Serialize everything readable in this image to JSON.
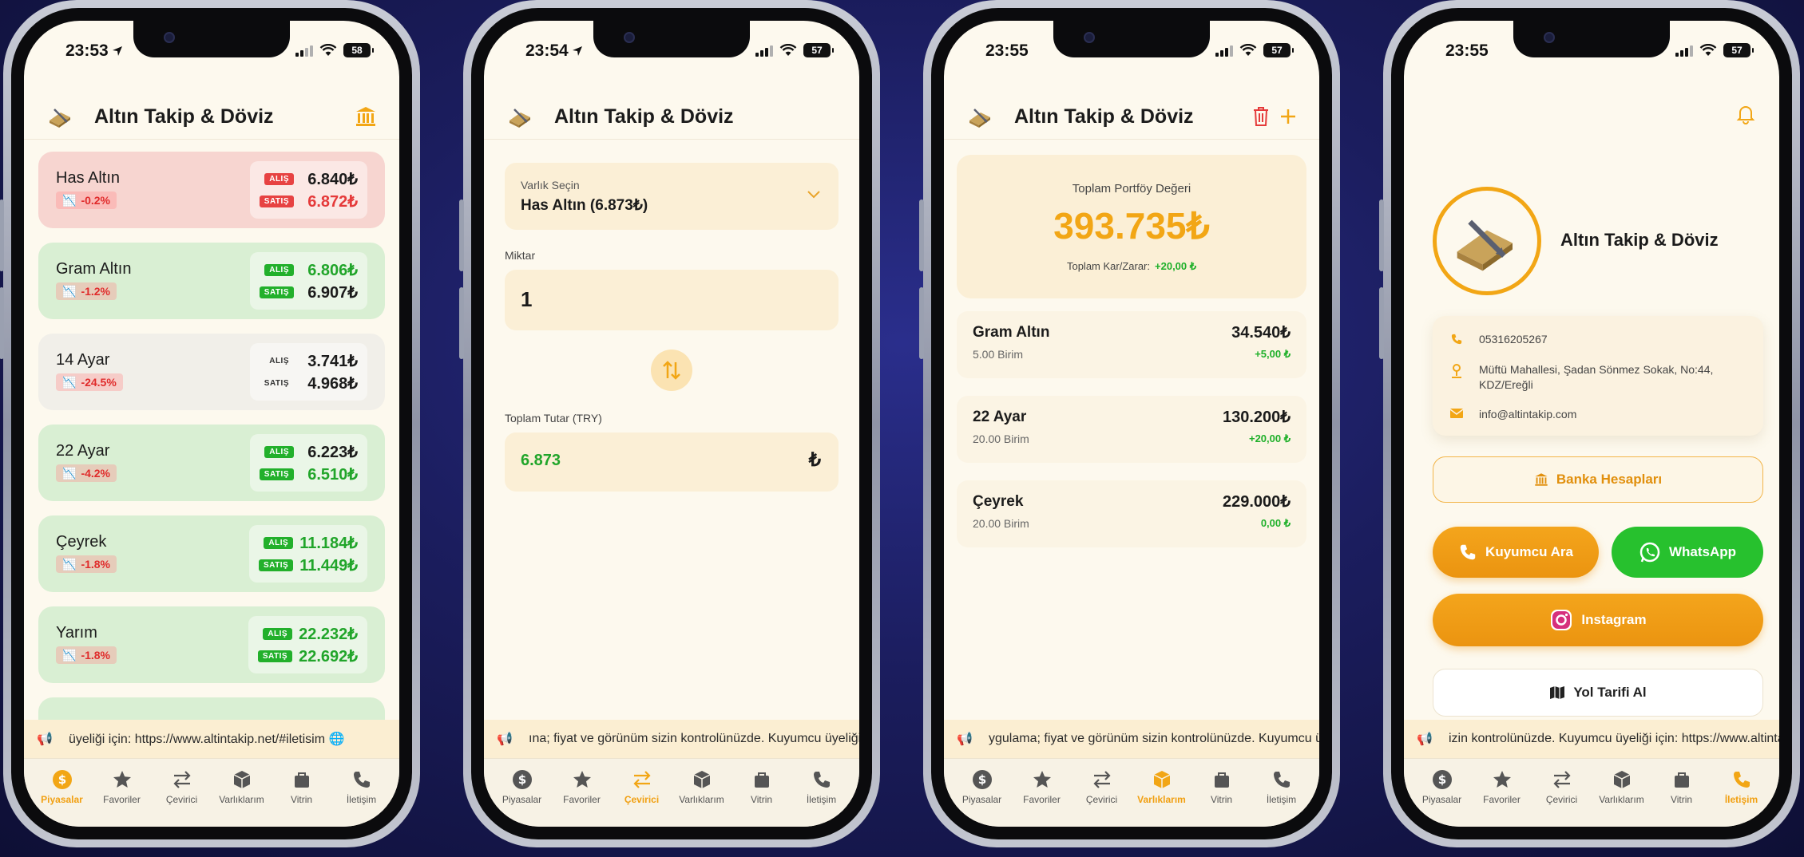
{
  "app": {
    "title": "Altın Takip & Döviz"
  },
  "colors": {
    "accent": "#f2a615",
    "up": "#21a52a",
    "down": "#e53a3a",
    "bg": "#fdf9ee"
  },
  "tabs": [
    {
      "label": "Piyasalar",
      "icon": "dollar-icon"
    },
    {
      "label": "Favoriler",
      "icon": "star-icon"
    },
    {
      "label": "Çevirici",
      "icon": "swap-icon"
    },
    {
      "label": "Varlıklarım",
      "icon": "box-icon"
    },
    {
      "label": "Vitrin",
      "icon": "bag-icon"
    },
    {
      "label": "İletişim",
      "icon": "phone-icon"
    }
  ],
  "screens": [
    {
      "time": "23:53",
      "battery": "58",
      "active_tab": 0,
      "ticker": "üyeliği için: https://www.altintakip.net/#iletisim 🌐",
      "markets": [
        {
          "name": "Has Altın",
          "change": "-0.2%",
          "buy_label": "ALIŞ",
          "buy": "6.840₺",
          "sell_label": "SATIŞ",
          "sell": "6.872₺"
        },
        {
          "name": "Gram Altın",
          "change": "-1.2%",
          "buy_label": "ALIŞ",
          "buy": "6.806₺",
          "sell_label": "SATIŞ",
          "sell": "6.907₺"
        },
        {
          "name": "14 Ayar",
          "change": "-24.5%",
          "buy_label": "ALIŞ",
          "buy": "3.741₺",
          "sell_label": "SATIŞ",
          "sell": "4.968₺"
        },
        {
          "name": "22 Ayar",
          "change": "-4.2%",
          "buy_label": "ALIŞ",
          "buy": "6.223₺",
          "sell_label": "SATIŞ",
          "sell": "6.510₺"
        },
        {
          "name": "Çeyrek",
          "change": "-1.8%",
          "buy_label": "ALIŞ",
          "buy": "11.184₺",
          "sell_label": "SATIŞ",
          "sell": "11.449₺"
        },
        {
          "name": "Yarım",
          "change": "-1.8%",
          "buy_label": "ALIŞ",
          "buy": "22.232₺",
          "sell_label": "SATIŞ",
          "sell": "22.692₺"
        }
      ]
    },
    {
      "time": "23:54",
      "battery": "57",
      "active_tab": 2,
      "ticker": "ına; fiyat ve görünüm sizin kontrolünüzde. Kuyumcu üyeliği iç",
      "converter": {
        "asset_label": "Varlık Seçin",
        "asset_value": "Has Altın (6.873₺)",
        "amount_label": "Miktar",
        "amount_value": "1",
        "total_label": "Toplam Tutar (TRY)",
        "total_value": "6.873",
        "currency_symbol": "₺"
      }
    },
    {
      "time": "23:55",
      "battery": "57",
      "active_tab": 3,
      "ticker": "ygulama; fiyat ve görünüm sizin kontrolünüzde. Kuyumcu üye",
      "portfolio": {
        "total_label": "Toplam Portföy Değeri",
        "total_value": "393.735₺",
        "pnl_label": "Toplam Kar/Zarar:",
        "pnl_value": "+20,00 ₺",
        "assets": [
          {
            "name": "Gram Altın",
            "units": "5.00 Birim",
            "value": "34.540₺",
            "pnl": "+5,00 ₺"
          },
          {
            "name": "22 Ayar",
            "units": "20.00 Birim",
            "value": "130.200₺",
            "pnl": "+20,00 ₺"
          },
          {
            "name": "Çeyrek",
            "units": "20.00 Birim",
            "value": "229.000₺",
            "pnl": "0,00 ₺"
          }
        ]
      }
    },
    {
      "time": "23:55",
      "battery": "57",
      "active_tab": 5,
      "ticker": "izin kontrolünüzde. Kuyumcu üyeliği için: https://www.altintak",
      "contact": {
        "brand": "Altın Takip & Döviz",
        "phone": "05316205267",
        "address": "Müftü Mahallesi, Şadan Sönmez Sokak, No:44, KDZ/Ereğli",
        "email": "info@altintakip.com",
        "bank_button": "Banka Hesapları",
        "call_button": "Kuyumcu Ara",
        "whatsapp_button": "WhatsApp",
        "instagram_button": "Instagram",
        "directions_button": "Yol Tarifi Al"
      }
    }
  ]
}
